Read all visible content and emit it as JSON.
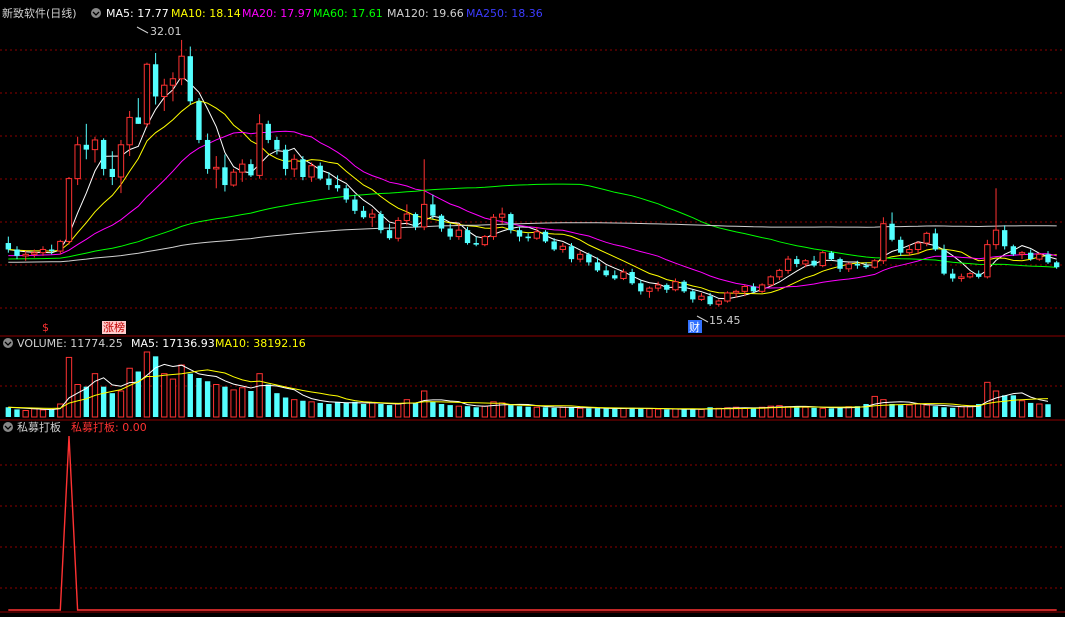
{
  "window": {
    "title": "新致软件(日线)"
  },
  "colors": {
    "up": "#ff3232",
    "down": "#54ffff",
    "ma5": "#ffffff",
    "ma10": "#ffff00",
    "ma20": "#ff00ff",
    "ma60": "#00ff00",
    "ma120": "#d0d0d0",
    "ma250": "#3c3cff",
    "grid": "#8b0000",
    "text": "#d0d0d0"
  },
  "price_panel": {
    "header": {
      "title": "新致软件(日线)",
      "ma5": "MA5: 17.77",
      "ma10": "MA10: 18.14",
      "ma20": "MA20: 17.97",
      "ma60": "MA60: 17.61",
      "ma120": "MA120: 19.66",
      "ma250": "MA250: 18.36"
    },
    "high_marker": "32.01",
    "low_marker": "15.45",
    "tags": {
      "dollar": "$",
      "zhangbang": "涨榜",
      "cai": "财"
    }
  },
  "volume_panel": {
    "header": {
      "label": "VOLUME: 11774.25",
      "ma5": "MA5: 17136.93",
      "ma10": "MA10: 38192.16"
    }
  },
  "indicator_panel": {
    "header": {
      "name": "私募打板",
      "value": "私募打板: 0.00"
    }
  },
  "chart_data": [
    {
      "type": "candlestick",
      "title": "新致软件(日线)",
      "ylim": [
        14,
        33
      ],
      "ohlc": [
        [
          19.4,
          19.8,
          18.8,
          19.0
        ],
        [
          19.0,
          19.2,
          18.4,
          18.6
        ],
        [
          18.6,
          18.9,
          18.3,
          18.7
        ],
        [
          18.7,
          19.0,
          18.5,
          18.8
        ],
        [
          18.8,
          19.2,
          18.6,
          19.0
        ],
        [
          19.0,
          19.3,
          18.7,
          18.9
        ],
        [
          18.9,
          19.6,
          18.7,
          19.5
        ],
        [
          19.5,
          23.5,
          19.3,
          23.4
        ],
        [
          23.4,
          26.0,
          23.0,
          25.5
        ],
        [
          25.5,
          26.8,
          24.6,
          25.2
        ],
        [
          25.2,
          26.0,
          24.4,
          25.8
        ],
        [
          25.8,
          25.9,
          23.6,
          24.0
        ],
        [
          24.0,
          25.1,
          23.0,
          23.5
        ],
        [
          23.5,
          25.8,
          22.5,
          25.5
        ],
        [
          25.5,
          27.6,
          24.8,
          27.2
        ],
        [
          27.2,
          28.4,
          26.8,
          26.8
        ],
        [
          26.8,
          30.6,
          26.6,
          30.5
        ],
        [
          30.5,
          31.2,
          28.0,
          28.5
        ],
        [
          28.5,
          29.6,
          27.6,
          29.2
        ],
        [
          29.2,
          30.0,
          28.2,
          29.6
        ],
        [
          29.6,
          32.01,
          29.2,
          31.0
        ],
        [
          31.0,
          31.6,
          28.0,
          28.2
        ],
        [
          28.2,
          28.4,
          25.6,
          25.8
        ],
        [
          25.8,
          26.2,
          23.7,
          24.0
        ],
        [
          24.0,
          24.8,
          22.8,
          24.1
        ],
        [
          24.1,
          24.9,
          22.6,
          23.0
        ],
        [
          23.0,
          24.0,
          22.9,
          23.8
        ],
        [
          23.8,
          24.6,
          23.2,
          24.3
        ],
        [
          24.3,
          24.6,
          23.5,
          23.6
        ],
        [
          23.6,
          27.4,
          23.4,
          26.8
        ],
        [
          26.8,
          27.0,
          25.6,
          25.8
        ],
        [
          25.8,
          26.0,
          24.9,
          25.2
        ],
        [
          25.2,
          25.5,
          23.6,
          24.0
        ],
        [
          24.0,
          24.9,
          23.5,
          24.6
        ],
        [
          24.6,
          24.8,
          23.3,
          23.5
        ],
        [
          23.5,
          24.4,
          23.2,
          24.2
        ],
        [
          24.2,
          24.4,
          23.3,
          23.4
        ],
        [
          23.4,
          23.8,
          22.7,
          23.0
        ],
        [
          23.0,
          23.6,
          22.6,
          22.8
        ],
        [
          22.8,
          23.0,
          21.9,
          22.1
        ],
        [
          22.1,
          22.4,
          21.2,
          21.4
        ],
        [
          21.4,
          21.7,
          20.9,
          21.0
        ],
        [
          21.0,
          21.5,
          20.4,
          21.2
        ],
        [
          21.2,
          21.4,
          20.0,
          20.2
        ],
        [
          20.2,
          20.6,
          19.6,
          19.7
        ],
        [
          19.7,
          21.0,
          19.5,
          20.8
        ],
        [
          20.8,
          21.8,
          20.5,
          21.2
        ],
        [
          21.2,
          21.3,
          20.2,
          20.4
        ],
        [
          20.4,
          24.6,
          20.2,
          21.8
        ],
        [
          21.8,
          22.4,
          20.9,
          21.1
        ],
        [
          21.1,
          21.2,
          20.1,
          20.3
        ],
        [
          20.3,
          20.6,
          19.6,
          19.8
        ],
        [
          19.8,
          20.6,
          19.6,
          20.2
        ],
        [
          20.2,
          20.4,
          19.3,
          19.4
        ],
        [
          19.4,
          19.8,
          19.2,
          19.3
        ],
        [
          19.3,
          19.9,
          19.2,
          19.8
        ],
        [
          19.8,
          21.2,
          19.6,
          21.0
        ],
        [
          21.0,
          21.6,
          20.6,
          21.2
        ],
        [
          21.2,
          21.3,
          20.0,
          20.2
        ],
        [
          20.2,
          20.4,
          19.5,
          19.8
        ],
        [
          19.8,
          20.0,
          19.5,
          19.7
        ],
        [
          19.7,
          20.4,
          19.6,
          20.1
        ],
        [
          20.1,
          20.2,
          19.4,
          19.5
        ],
        [
          19.5,
          19.7,
          18.9,
          19.0
        ],
        [
          19.0,
          19.4,
          18.8,
          19.2
        ],
        [
          19.2,
          19.4,
          18.2,
          18.4
        ],
        [
          18.4,
          18.9,
          18.2,
          18.7
        ],
        [
          18.7,
          18.8,
          18.0,
          18.2
        ],
        [
          18.2,
          18.5,
          17.6,
          17.7
        ],
        [
          17.7,
          18.0,
          17.3,
          17.4
        ],
        [
          17.4,
          17.7,
          17.1,
          17.2
        ],
        [
          17.2,
          17.8,
          17.1,
          17.6
        ],
        [
          17.6,
          17.8,
          16.8,
          16.9
        ],
        [
          16.9,
          17.1,
          16.2,
          16.4
        ],
        [
          16.4,
          16.7,
          16.0,
          16.6
        ],
        [
          16.6,
          17.0,
          16.4,
          16.8
        ],
        [
          16.8,
          16.9,
          16.3,
          16.5
        ],
        [
          16.5,
          17.2,
          16.4,
          17.0
        ],
        [
          17.0,
          17.1,
          16.3,
          16.4
        ],
        [
          16.4,
          16.5,
          15.7,
          15.9
        ],
        [
          15.9,
          16.3,
          15.8,
          16.1
        ],
        [
          16.1,
          16.3,
          15.5,
          15.6
        ],
        [
          15.6,
          15.9,
          15.45,
          15.8
        ],
        [
          15.8,
          16.4,
          15.7,
          16.3
        ],
        [
          16.3,
          16.5,
          16.0,
          16.4
        ],
        [
          16.4,
          16.8,
          16.1,
          16.7
        ],
        [
          16.7,
          16.9,
          16.3,
          16.4
        ],
        [
          16.4,
          16.9,
          16.3,
          16.8
        ],
        [
          16.8,
          17.4,
          16.7,
          17.3
        ],
        [
          17.3,
          17.8,
          17.1,
          17.7
        ],
        [
          17.7,
          18.6,
          17.5,
          18.4
        ],
        [
          18.4,
          18.6,
          17.9,
          18.1
        ],
        [
          18.1,
          18.4,
          17.9,
          18.3
        ],
        [
          18.3,
          18.6,
          17.9,
          18.0
        ],
        [
          18.0,
          18.9,
          17.9,
          18.8
        ],
        [
          18.8,
          18.9,
          18.3,
          18.4
        ],
        [
          18.4,
          18.5,
          17.6,
          17.8
        ],
        [
          17.8,
          18.2,
          17.6,
          18.1
        ],
        [
          18.1,
          18.3,
          17.8,
          18.0
        ],
        [
          18.0,
          18.2,
          17.8,
          17.9
        ],
        [
          17.9,
          18.4,
          17.8,
          18.3
        ],
        [
          18.3,
          21.0,
          18.1,
          20.6
        ],
        [
          20.6,
          21.3,
          19.5,
          19.6
        ],
        [
          19.6,
          19.8,
          18.6,
          18.8
        ],
        [
          18.8,
          19.3,
          18.6,
          19.0
        ],
        [
          19.0,
          19.5,
          18.7,
          19.4
        ],
        [
          19.4,
          20.1,
          19.2,
          20.0
        ],
        [
          20.0,
          20.3,
          18.9,
          19.0
        ],
        [
          19.0,
          19.3,
          17.4,
          17.5
        ],
        [
          17.5,
          17.8,
          17.0,
          17.2
        ],
        [
          17.2,
          17.5,
          17.0,
          17.3
        ],
        [
          17.3,
          17.6,
          17.2,
          17.5
        ],
        [
          17.5,
          17.7,
          17.2,
          17.3
        ],
        [
          17.3,
          19.6,
          17.2,
          19.3
        ],
        [
          19.3,
          22.8,
          19.0,
          20.2
        ],
        [
          20.2,
          20.5,
          19.0,
          19.2
        ],
        [
          19.2,
          19.3,
          18.6,
          18.7
        ],
        [
          18.7,
          18.9,
          18.4,
          18.8
        ],
        [
          18.8,
          19.0,
          18.3,
          18.4
        ],
        [
          18.4,
          18.8,
          18.3,
          18.7
        ],
        [
          18.7,
          18.9,
          18.1,
          18.2
        ],
        [
          18.2,
          18.3,
          17.8,
          17.9
        ]
      ],
      "ma5_last": 17.77,
      "ma10_last": 18.14,
      "ma20_last": 17.97,
      "ma60_last": 17.61,
      "ma120_last": 19.66,
      "ma250_last": 18.36,
      "high": 32.01,
      "low": 15.45
    },
    {
      "type": "bar",
      "title": "VOLUME",
      "values": [
        9000,
        7000,
        6000,
        7500,
        6500,
        7000,
        12000,
        55000,
        30000,
        28000,
        40000,
        28000,
        22000,
        24000,
        45000,
        42000,
        60000,
        56000,
        40000,
        35000,
        48000,
        40000,
        36000,
        33000,
        30000,
        28000,
        25000,
        27000,
        24000,
        40000,
        30000,
        22000,
        18000,
        16000,
        15000,
        14000,
        13000,
        12000,
        14000,
        13000,
        14000,
        12000,
        13000,
        12000,
        11000,
        12000,
        16000,
        13000,
        24000,
        14000,
        12000,
        11000,
        10000,
        10000,
        9000,
        10000,
        14000,
        13000,
        11000,
        10000,
        9500,
        9000,
        9000,
        8500,
        9000,
        9000,
        8000,
        8000,
        8000,
        7800,
        7500,
        8000,
        8500,
        7800,
        7600,
        7200,
        7000,
        7400,
        7000,
        7500,
        7000,
        9000,
        8000,
        8500,
        9000,
        8000,
        8500,
        9000,
        10000,
        10500,
        9500,
        10000,
        9000,
        8500,
        8000,
        8000,
        9000,
        9500,
        10000,
        12000,
        19000,
        16000,
        12000,
        11000,
        11000,
        12000,
        11000,
        10000,
        9000,
        8500,
        9500,
        10000,
        12000,
        32000,
        24000,
        20000,
        20000,
        15000,
        13000,
        12000,
        11774
      ],
      "ma5_last": 17136.93,
      "ma10_last": 38192.16
    },
    {
      "type": "line",
      "title": "私募打板",
      "note_series": [
        0,
        0,
        0,
        0,
        0,
        0,
        0,
        1,
        0,
        0,
        0,
        0,
        0,
        0,
        0,
        0,
        0,
        0,
        0,
        0,
        0,
        0,
        0,
        0,
        0,
        0,
        0,
        0,
        0,
        0,
        0,
        0,
        0,
        0,
        0,
        0,
        0,
        0,
        0,
        0,
        0,
        0,
        0,
        0,
        0,
        0,
        0,
        0,
        0,
        0,
        0,
        0,
        0,
        0,
        0,
        0,
        0,
        0,
        0,
        0,
        0,
        0,
        0,
        0,
        0,
        0,
        0,
        0,
        0,
        0,
        0,
        0,
        0,
        0,
        0,
        0,
        0,
        0,
        0,
        0,
        0,
        0,
        0,
        0,
        0,
        0,
        0,
        0,
        0,
        0,
        0,
        0,
        0,
        0,
        0,
        0,
        0,
        0,
        0,
        0,
        0,
        0,
        0,
        0,
        0,
        0,
        0,
        0,
        0,
        0,
        0,
        0,
        0,
        0,
        0,
        0,
        0,
        0,
        0,
        0,
        0,
        0
      ],
      "last": 0.0
    }
  ]
}
